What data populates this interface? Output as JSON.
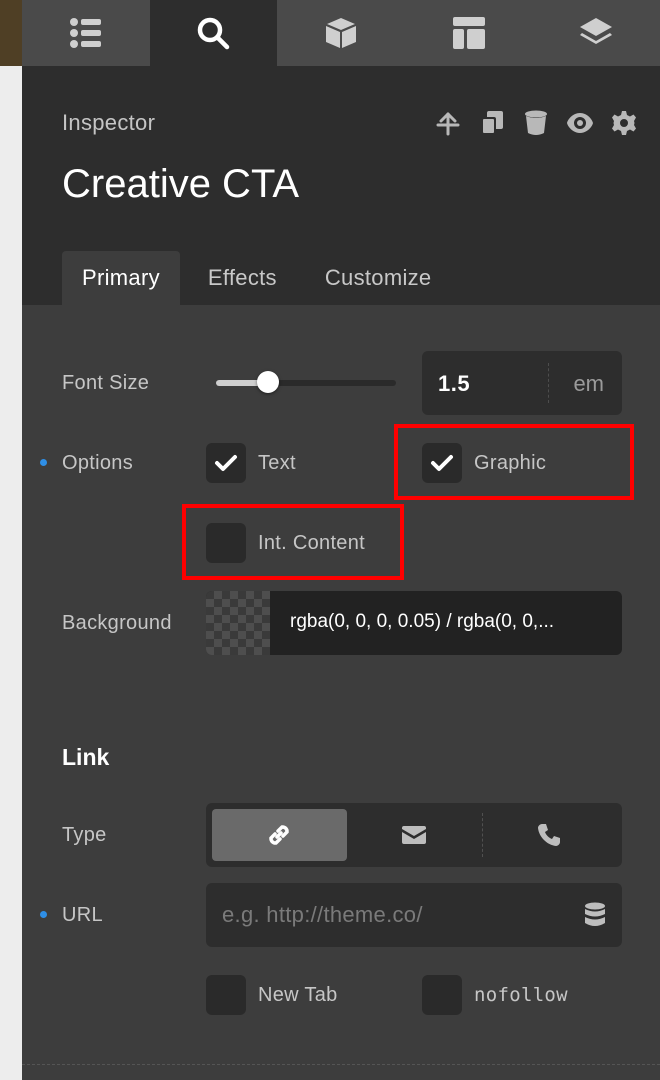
{
  "nav": {
    "tabs": [
      {
        "icon": "list-icon"
      },
      {
        "icon": "search-icon"
      },
      {
        "icon": "cube-icon"
      },
      {
        "icon": "layout-icon"
      },
      {
        "icon": "layers-icon"
      }
    ]
  },
  "header": {
    "label": "Inspector",
    "title": "Creative CTA",
    "toolbar": [
      "arrow-up-icon",
      "duplicate-icon",
      "delete-icon",
      "visibility-icon",
      "settings-icon"
    ]
  },
  "tabs": [
    {
      "label": "Primary"
    },
    {
      "label": "Effects"
    },
    {
      "label": "Customize"
    }
  ],
  "font_size": {
    "label": "Font Size",
    "value": "1.5",
    "unit": "em",
    "slider_fraction": 0.29
  },
  "options": {
    "label": "Options",
    "items": [
      {
        "label": "Text",
        "checked": true
      },
      {
        "label": "Graphic",
        "checked": true
      },
      {
        "label": "Int. Content",
        "checked": false
      }
    ]
  },
  "background": {
    "label": "Background",
    "value": "rgba(0, 0, 0, 0.05) / rgba(0, 0,..."
  },
  "link": {
    "section_title": "Link",
    "type_label": "Type",
    "types": [
      "link-icon",
      "mail-icon",
      "phone-icon"
    ],
    "url_label": "URL",
    "url_placeholder": "e.g. http://theme.co/",
    "new_tab": "New Tab",
    "nofollow": "nofollow"
  },
  "colors": {
    "accent_dot": "#2f8fe6",
    "highlight": "#ff0000"
  }
}
